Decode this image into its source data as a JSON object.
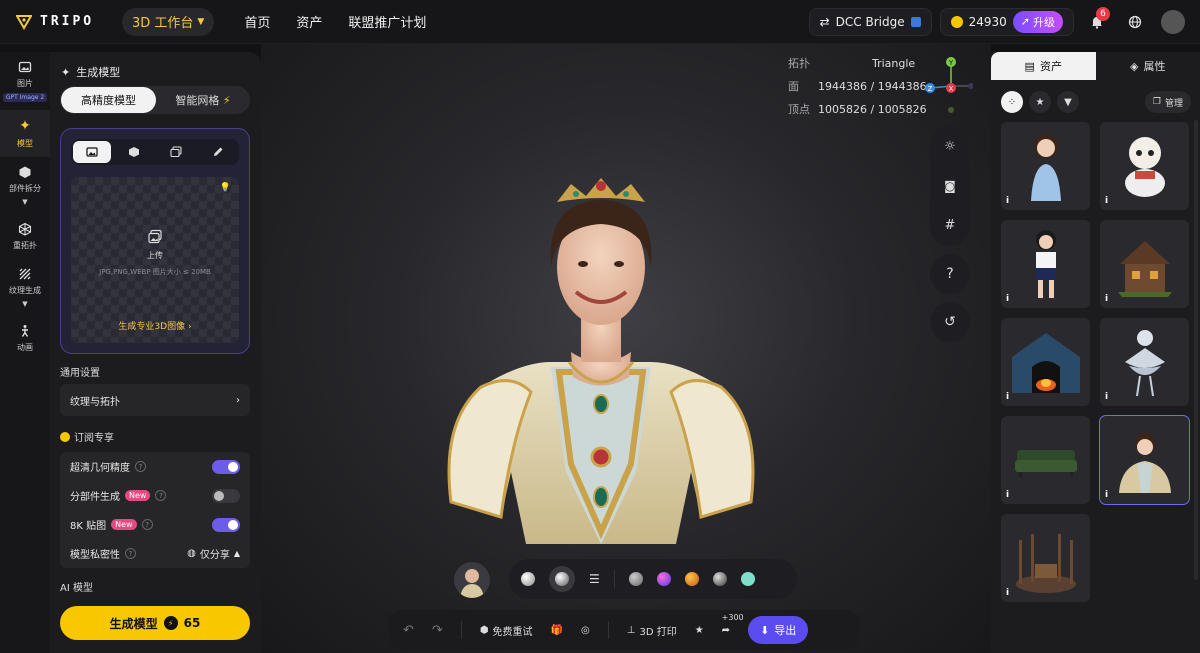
{
  "header": {
    "logo_text": "TRIPO",
    "workspace_label": "3D 工作台",
    "nav": [
      "首页",
      "资产",
      "联盟推广计划"
    ],
    "dcc_bridge": "DCC Bridge",
    "credits": "24930",
    "upgrade": "升级",
    "notification_count": "6"
  },
  "rail": {
    "items": [
      {
        "label": "图片",
        "tag": "GPT Image 2"
      },
      {
        "label": "模型"
      },
      {
        "label": "部件拆分"
      },
      {
        "label": "重拓扑"
      },
      {
        "label": "纹理生成"
      },
      {
        "label": "动画"
      }
    ]
  },
  "panel": {
    "title": "生成模型",
    "seg_active": "高精度模型",
    "seg_other": "智能网格",
    "upload_label": "上传",
    "upload_hint": "JPG,PNG,WEBP 图片大小 ≤ 20MB",
    "pro_link": "生成专业3D图像",
    "general_settings": "通用设置",
    "texture_topology": "纹理与拓扑",
    "subscription": "订阅专享",
    "options": [
      {
        "label": "超清几何精度",
        "new": "",
        "state": "on"
      },
      {
        "label": "分部件生成",
        "new": "New",
        "state": "off"
      },
      {
        "label": "8K 贴图",
        "new": "New",
        "state": "on"
      }
    ],
    "privacy_label": "模型私密性",
    "privacy_value": "仅分享",
    "ai_model": "AI 模型",
    "generate": "生成模型",
    "cost": "65"
  },
  "viewport": {
    "stats": [
      {
        "k": "拓扑",
        "v": "Triangle"
      },
      {
        "k": "面",
        "v": "1944386 / 1944386"
      },
      {
        "k": "顶点",
        "v": "1005826 / 1005826"
      }
    ],
    "gizmo": {
      "y": "Y",
      "x": "X",
      "z": "Z"
    },
    "help": "?",
    "bottom": {
      "retry": "免费重试",
      "print": "3D 打印",
      "bonus": "+300",
      "export": "导出"
    }
  },
  "assets": {
    "tab_assets": "资产",
    "tab_props": "属性",
    "manage": "管理",
    "info": "i"
  },
  "colors": {
    "accent": "#f7c700",
    "purple": "#6c5ce7"
  }
}
